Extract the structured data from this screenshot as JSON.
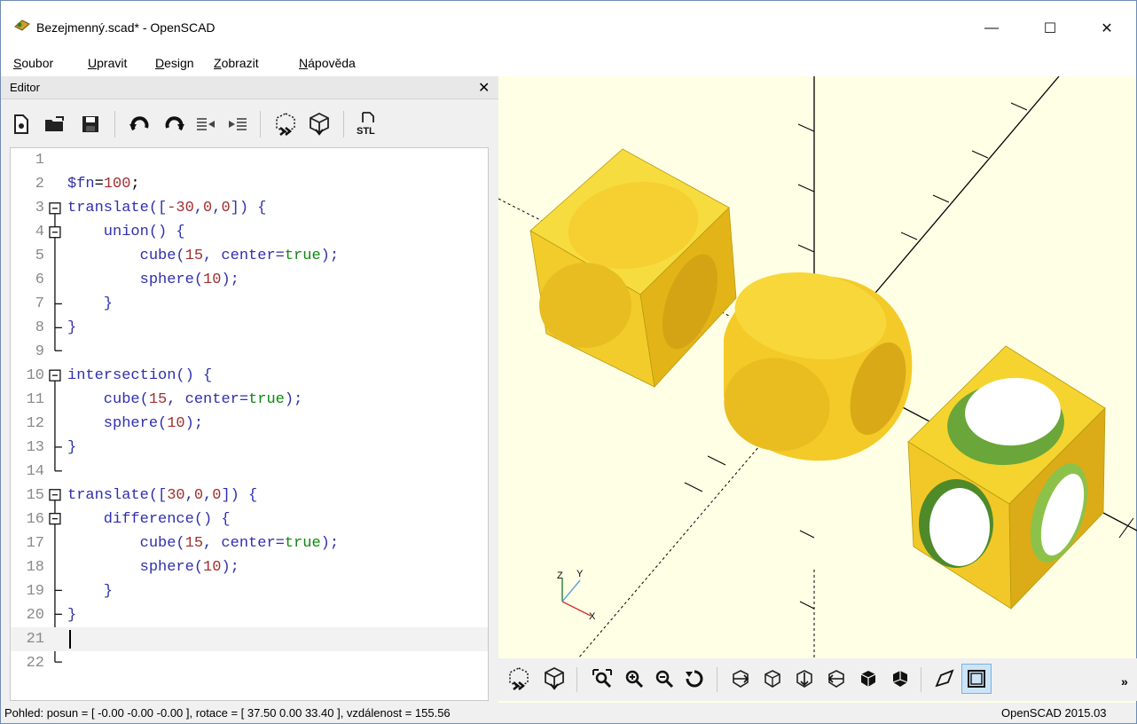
{
  "window": {
    "title": "Bezejmenný.scad* - OpenSCAD",
    "min_glyph": "—",
    "max_glyph": "☐",
    "close_glyph": "✕"
  },
  "menu": [
    {
      "first": "S",
      "rest": "oubor"
    },
    {
      "first": "U",
      "rest": "pravit"
    },
    {
      "first": "D",
      "rest": "esign"
    },
    {
      "first": "Z",
      "rest": "obrazit"
    },
    {
      "first": "N",
      "rest": "ápověda"
    }
  ],
  "editor": {
    "title": "Editor",
    "close_glyph": "✕",
    "toolbar_icons": [
      "new-file-icon",
      "open-folder-icon",
      "save-icon",
      "undo-icon",
      "redo-icon",
      "unindent-icon",
      "indent-icon",
      "preview-icon",
      "render-icon",
      "export-stl-icon"
    ],
    "stl_label": "STL",
    "lines": [
      {
        "n": "1",
        "tokens": []
      },
      {
        "n": "2",
        "tokens": [
          {
            "t": "$fn",
            "c": "var"
          },
          {
            "t": "=",
            "c": ""
          },
          {
            "t": "100",
            "c": "num"
          },
          {
            "t": ";",
            "c": ""
          }
        ]
      },
      {
        "n": "3",
        "tokens": [
          {
            "t": "translate",
            "c": "kw"
          },
          {
            "t": "([",
            "c": "kw"
          },
          {
            "t": "-30",
            "c": "num"
          },
          {
            "t": ",",
            "c": "kw"
          },
          {
            "t": "0",
            "c": "num"
          },
          {
            "t": ",",
            "c": "kw"
          },
          {
            "t": "0",
            "c": "num"
          },
          {
            "t": "]) {",
            "c": "kw"
          }
        ]
      },
      {
        "n": "4",
        "tokens": [
          {
            "t": "    union() {",
            "c": "kw"
          }
        ]
      },
      {
        "n": "5",
        "tokens": [
          {
            "t": "        cube(",
            "c": "kw"
          },
          {
            "t": "15",
            "c": "num"
          },
          {
            "t": ", center=",
            "c": "kw"
          },
          {
            "t": "true",
            "c": "lit"
          },
          {
            "t": ");",
            "c": "kw"
          }
        ]
      },
      {
        "n": "6",
        "tokens": [
          {
            "t": "        sphere(",
            "c": "kw"
          },
          {
            "t": "10",
            "c": "num"
          },
          {
            "t": ");",
            "c": "kw"
          }
        ]
      },
      {
        "n": "7",
        "tokens": [
          {
            "t": "    }",
            "c": "kw"
          }
        ]
      },
      {
        "n": "8",
        "tokens": [
          {
            "t": "}",
            "c": "kw"
          }
        ]
      },
      {
        "n": "9",
        "tokens": []
      },
      {
        "n": "10",
        "tokens": [
          {
            "t": "intersection() {",
            "c": "kw"
          }
        ]
      },
      {
        "n": "11",
        "tokens": [
          {
            "t": "    cube(",
            "c": "kw"
          },
          {
            "t": "15",
            "c": "num"
          },
          {
            "t": ", center=",
            "c": "kw"
          },
          {
            "t": "true",
            "c": "lit"
          },
          {
            "t": ");",
            "c": "kw"
          }
        ]
      },
      {
        "n": "12",
        "tokens": [
          {
            "t": "    sphere(",
            "c": "kw"
          },
          {
            "t": "10",
            "c": "num"
          },
          {
            "t": ");",
            "c": "kw"
          }
        ]
      },
      {
        "n": "13",
        "tokens": [
          {
            "t": "}",
            "c": "kw"
          }
        ]
      },
      {
        "n": "14",
        "tokens": []
      },
      {
        "n": "15",
        "tokens": [
          {
            "t": "translate",
            "c": "kw"
          },
          {
            "t": "([",
            "c": "kw"
          },
          {
            "t": "30",
            "c": "num"
          },
          {
            "t": ",",
            "c": "kw"
          },
          {
            "t": "0",
            "c": "num"
          },
          {
            "t": ",",
            "c": "kw"
          },
          {
            "t": "0",
            "c": "num"
          },
          {
            "t": "]) {",
            "c": "kw"
          }
        ]
      },
      {
        "n": "16",
        "tokens": [
          {
            "t": "    difference() {",
            "c": "kw"
          }
        ]
      },
      {
        "n": "17",
        "tokens": [
          {
            "t": "        cube(",
            "c": "kw"
          },
          {
            "t": "15",
            "c": "num"
          },
          {
            "t": ", center=",
            "c": "kw"
          },
          {
            "t": "true",
            "c": "lit"
          },
          {
            "t": ");",
            "c": "kw"
          }
        ]
      },
      {
        "n": "18",
        "tokens": [
          {
            "t": "        sphere(",
            "c": "kw"
          },
          {
            "t": "10",
            "c": "num"
          },
          {
            "t": ");",
            "c": "kw"
          }
        ]
      },
      {
        "n": "19",
        "tokens": [
          {
            "t": "    }",
            "c": "kw"
          }
        ]
      },
      {
        "n": "20",
        "tokens": [
          {
            "t": "}",
            "c": "kw"
          }
        ]
      },
      {
        "n": "21",
        "tokens": [],
        "current": true
      },
      {
        "n": "22",
        "tokens": []
      }
    ]
  },
  "viewport": {
    "background": "#ffffe5",
    "model_color": "#f5d02a",
    "inner_color": "#6aa63a",
    "axis_labels": {
      "z": "Z",
      "y": "Y",
      "x": "X"
    }
  },
  "view_toolbar": {
    "icons": [
      "preview-icon",
      "render-icon",
      "view-all-icon",
      "zoom-in-icon",
      "zoom-out-icon",
      "reset-view-icon",
      "view-right-icon",
      "view-top-icon",
      "view-bottom-icon",
      "view-left-icon",
      "view-front-icon",
      "view-back-icon",
      "perspective-icon",
      "orthogonal-icon"
    ],
    "more_glyph": "»"
  },
  "status": {
    "left": "Pohled: posun = [ -0.00 -0.00 -0.00 ], rotace = [ 37.50 0.00 33.40 ], vzdálenost = 155.56",
    "right": "OpenSCAD 2015.03"
  }
}
